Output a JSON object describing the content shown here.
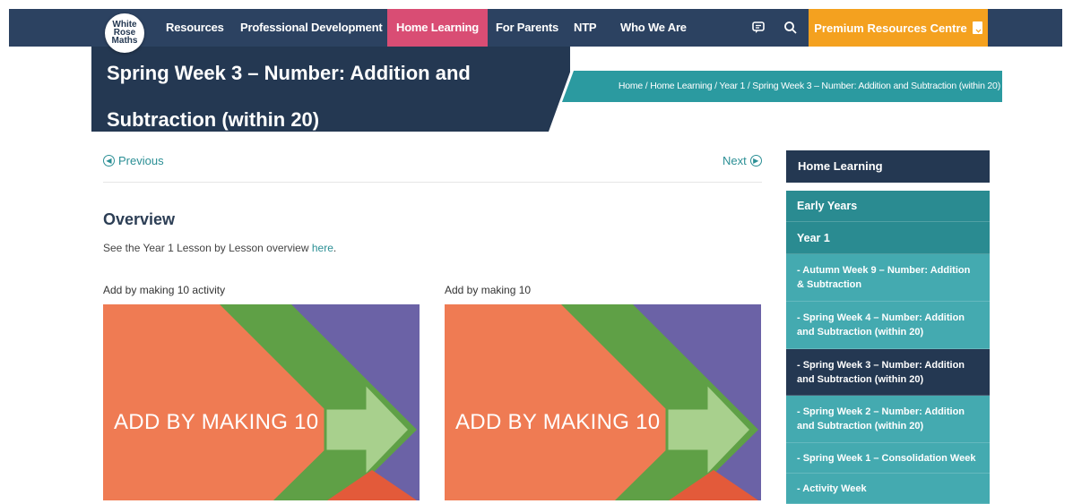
{
  "brand": {
    "logo_line1": "White",
    "logo_line2": "Rose",
    "logo_line3": "Maths"
  },
  "nav": {
    "items": [
      "Resources",
      "Professional Development",
      "Home Learning",
      "For Parents",
      "NTP",
      "Who We Are"
    ],
    "active_item": "Home Learning",
    "premium_label": "Premium Resources Centre"
  },
  "icons": {
    "chat": "chat-bubble-icon",
    "search": "search-icon",
    "premium": "document-download-icon",
    "prev": "arrow-left-circle-icon",
    "next": "arrow-right-circle-icon"
  },
  "colors": {
    "nav_bg": "#2c4261",
    "active_pink": "#d94d74",
    "premium_orange": "#f4a11f",
    "teal": "#2b9aa0",
    "navy": "#243852"
  },
  "page": {
    "title": "Spring Week 3 – Number: Addition and Subtraction (within 20)",
    "breadcrumb": "Home / Home Learning / Year 1 / Spring Week 3 – Number: Addition and Subtraction (within 20)"
  },
  "pager": {
    "previous": "Previous",
    "next": "Next"
  },
  "overview": {
    "heading": "Overview",
    "text": "See the Year 1 Lesson by Lesson overview",
    "link": "here"
  },
  "cards": [
    {
      "label": "Add by making 10 activity",
      "thumb_text": "ADD BY MAKING 10"
    },
    {
      "label": "Add by making 10",
      "thumb_text": "ADD BY MAKING 10"
    }
  ],
  "sidebar": {
    "heading": "Home Learning",
    "items": [
      "Early Years",
      "Year 1",
      "- Autumn Week 9 – Number: Addition & Subtraction",
      "- Spring Week 4 – Number: Addition and Subtraction (within 20)",
      "- Spring Week 3 – Number: Addition and Subtraction (within 20)",
      "- Spring Week 2 – Number: Addition and Subtraction (within 20)",
      "- Spring Week 1 – Consolidation Week",
      "- Activity Week"
    ]
  }
}
